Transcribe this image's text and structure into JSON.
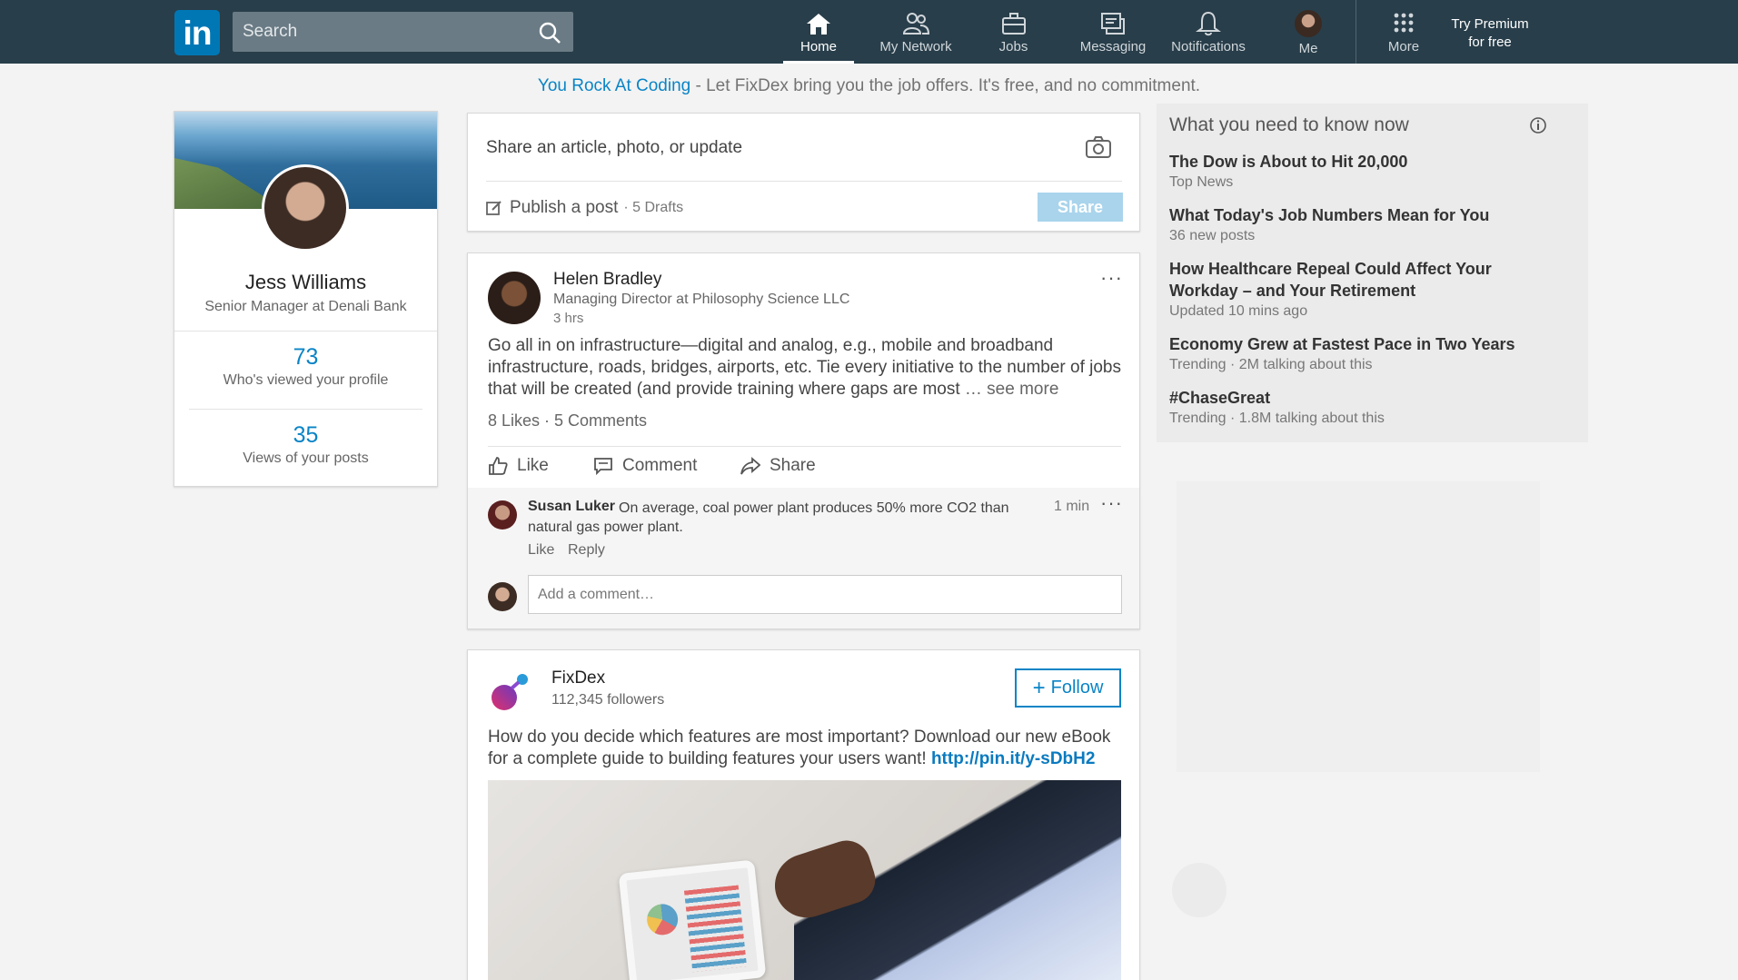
{
  "nav": {
    "logo": "in",
    "search_placeholder": "Search",
    "items": [
      {
        "label": "Home",
        "icon": "home-icon"
      },
      {
        "label": "My Network",
        "icon": "network-icon"
      },
      {
        "label": "Jobs",
        "icon": "briefcase-icon"
      },
      {
        "label": "Messaging",
        "icon": "messaging-icon"
      },
      {
        "label": "Notifications",
        "icon": "bell-icon"
      },
      {
        "label": "Me",
        "icon": "avatar"
      },
      {
        "label": "More",
        "icon": "grid-icon"
      }
    ],
    "premium_line1": "Try Premium",
    "premium_line2": "for free"
  },
  "promo": {
    "highlight": "You Rock At Coding",
    "text": " - Let FixDex bring you the job offers. It's free, and no commitment."
  },
  "profile": {
    "name": "Jess Williams",
    "title": "Senior Manager at Denali Bank",
    "stats": [
      {
        "value": "73",
        "label": "Who's viewed your profile"
      },
      {
        "value": "35",
        "label": "Views of your posts"
      }
    ]
  },
  "sharebox": {
    "prompt": "Share an article, photo, or update",
    "publish_label": "Publish a post",
    "drafts": "· 5 Drafts",
    "share_button": "Share"
  },
  "post1": {
    "author": "Helen Bradley",
    "author_title": "Managing Director at Philosophy Science LLC",
    "time": "3 hrs",
    "body": "Go all in on infrastructure—digital and analog, e.g., mobile and broadband infrastructure, roads, bridges, airports, etc. Tie every initiative to the number of jobs that will be created (and provide training where gaps are most ",
    "see_more": "… see more",
    "reactions": "8 Likes · 5 Comments",
    "actions": {
      "like": "Like",
      "comment": "Comment",
      "share": "Share"
    },
    "comment": {
      "author": "Susan Luker",
      "text": "On average, coal power plant produces 50% more CO2 than natural gas power plant.",
      "time": "1 min",
      "like": "Like",
      "reply": "Reply"
    },
    "add_comment_placeholder": "Add a comment…"
  },
  "post2": {
    "name": "FixDex",
    "followers": "112,345 followers",
    "follow_label": "Follow",
    "body": "How do you decide which features are most important? Download our new eBook for a complete guide to building features your users want! ",
    "link": "http://pin.it/y-sDbH2"
  },
  "news": {
    "title": "What you need to know now",
    "items": [
      {
        "headline": "The Dow is About to Hit 20,000",
        "sub": "Top News"
      },
      {
        "headline": "What Today's Job Numbers Mean for You",
        "sub": "36 new posts"
      },
      {
        "headline": "How Healthcare Repeal Could Affect Your Workday – and Your Retirement",
        "sub": "Updated 10 mins ago"
      },
      {
        "headline": "Economy Grew at Fastest Pace in Two Years",
        "sub": "Trending · 2M talking about this"
      },
      {
        "headline": "#ChaseGreat",
        "sub": "Trending · 1.8M talking about this"
      }
    ]
  },
  "colors": {
    "nav_bg": "#283e4a",
    "brand_blue": "#0077b5",
    "link_blue": "#0a84c6",
    "page_bg": "#f3f3f3"
  }
}
